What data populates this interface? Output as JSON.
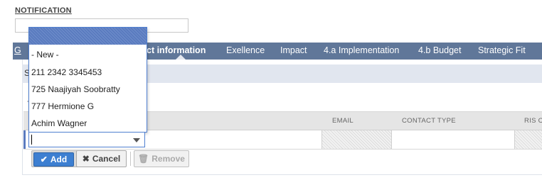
{
  "notification": {
    "label": "NOTIFICATION",
    "value": ""
  },
  "tabs": {
    "partial_first": "G",
    "contact_information": "ct information",
    "exellence": "Exellence",
    "impact": "Impact",
    "implementation": "4.a Implementation",
    "budget": "4.b Budget",
    "strategic_fit": "Strategic Fit"
  },
  "subheader": {
    "partial": "S"
  },
  "small_mark": "-",
  "grid": {
    "columns": {
      "email": "EMAIL",
      "contact_type": "CONTACT TYPE",
      "ris": "RIS CO"
    }
  },
  "dropdown": {
    "options": [
      "- New -",
      "211 2342 3345453",
      "725 Naajiyah Soobratty",
      "777 Hermione G",
      "Achim Wagner"
    ],
    "value": ""
  },
  "buttons": {
    "add": "Add",
    "cancel": "Cancel",
    "remove": "Remove"
  },
  "colors": {
    "tab_bar": "#607799",
    "accent": "#3d7fd1",
    "subheader": "#e1e6ef"
  }
}
